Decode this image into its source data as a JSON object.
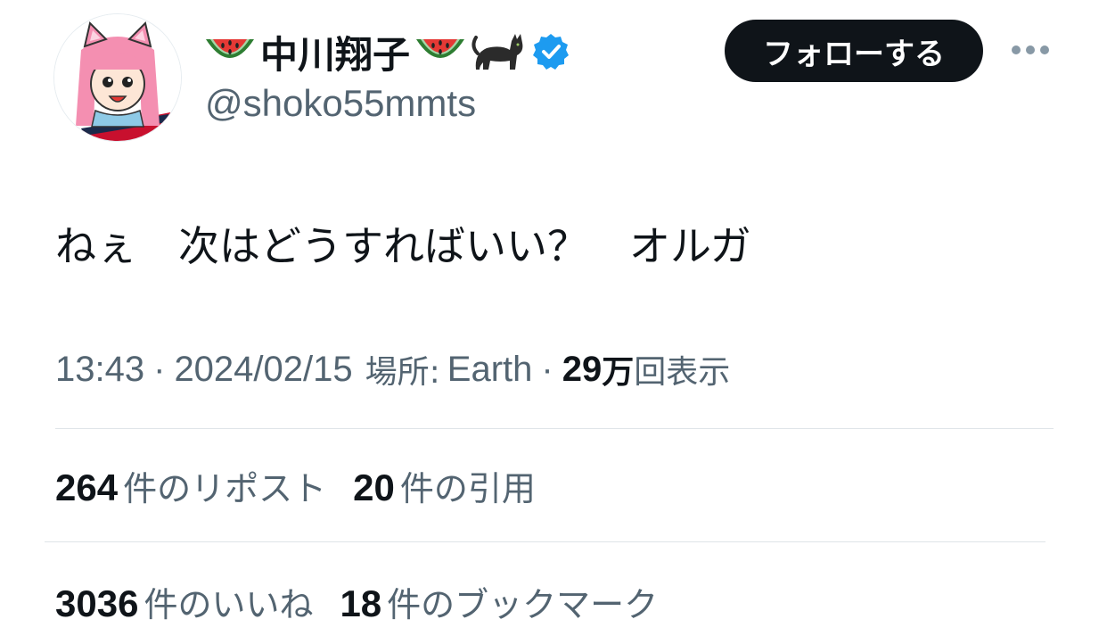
{
  "author": {
    "display_name": "中川翔子",
    "handle": "@shoko55mmts",
    "name_emojis": [
      "watermelon-emoji",
      "watermelon-emoji",
      "black-cat-emoji"
    ],
    "verified": true,
    "verified_color": "#1d9bf0"
  },
  "follow_button": {
    "label": "フォローする",
    "background": "#0f1419"
  },
  "more_button": {
    "icon": "ellipsis-icon"
  },
  "tweet": {
    "text": "ねぇ　次はどうすればいい？　オルガ"
  },
  "meta": {
    "time": "13:43",
    "separator": "·",
    "date": "2024/02/15",
    "place_label": "場所:",
    "place_value": "Earth",
    "views_count": "29",
    "views_unit": "万",
    "views_label": "回表示"
  },
  "stats": {
    "reposts": {
      "count": "264",
      "label": "件のリポスト"
    },
    "quotes": {
      "count": "20",
      "label": "件の引用"
    },
    "likes": {
      "count": "3036",
      "label": "件のいいね"
    },
    "bookmarks": {
      "count": "18",
      "label": "件のブックマーク"
    }
  },
  "colors": {
    "text_primary": "#0f1419",
    "text_secondary": "#536471",
    "divider": "#dfe4e8"
  }
}
